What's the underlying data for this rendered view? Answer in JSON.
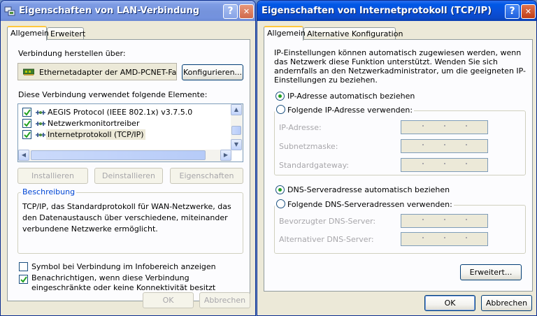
{
  "lan": {
    "title": "Eigenschaften von LAN-Verbindung",
    "tabs": [
      "Allgemein",
      "Erweitert"
    ],
    "connect_label": "Verbindung herstellen über:",
    "adapter": "Ethernetadapter der AMD-PCNET-Fa",
    "configure_button": "Konfigurieren...",
    "elements_label": "Diese Verbindung verwendet folgende Elemente:",
    "items": [
      {
        "label": "AEGIS Protocol (IEEE 802.1x) v3.7.5.0",
        "checked": true,
        "selected": false
      },
      {
        "label": "Netzwerkmonitortreiber",
        "checked": true,
        "selected": false
      },
      {
        "label": "Internetprotokoll (TCP/IP)",
        "checked": true,
        "selected": true
      }
    ],
    "install_button": "Installieren",
    "uninstall_button": "Deinstallieren",
    "properties_button": "Eigenschaften",
    "description_title": "Beschreibung",
    "description_text": "TCP/IP, das Standardprotokoll für WAN-Netzwerke, das den Datenaustausch über verschiedene, miteinander verbundene Netzwerke ermöglicht.",
    "show_icon_label": "Symbol bei Verbindung im Infobereich anzeigen",
    "show_icon_checked": false,
    "notify_label": "Benachrichtigen, wenn diese Verbindung eingeschränkte oder keine Konnektivität besitzt",
    "notify_checked": true,
    "ok_button": "OK",
    "cancel_button": "Abbrechen"
  },
  "tcp": {
    "title": "Eigenschaften von Internetprotokoll (TCP/IP)",
    "tabs": [
      "Allgemein",
      "Alternative Konfiguration"
    ],
    "intro": "IP-Einstellungen können automatisch zugewiesen werden, wenn das Netzwerk diese Funktion unterstützt. Wenden Sie sich andernfalls an den Netzwerkadministrator, um die geeigneten IP-Einstellungen zu beziehen.",
    "ip_auto_label": "IP-Adresse automatisch beziehen",
    "ip_auto_selected": true,
    "ip_manual_label": "Folgende IP-Adresse verwenden:",
    "ip_address_label": "IP-Adresse:",
    "subnet_label": "Subnetzmaske:",
    "gateway_label": "Standardgateway:",
    "dns_auto_label": "DNS-Serveradresse automatisch beziehen",
    "dns_auto_selected": true,
    "dns_manual_label": "Folgende DNS-Serveradressen verwenden:",
    "dns_pref_label": "Bevorzugter DNS-Server:",
    "dns_alt_label": "Alternativer DNS-Server:",
    "advanced_button": "Erweitert...",
    "ok_button": "OK",
    "cancel_button": "Abbrechen"
  },
  "titlebar_buttons": {
    "help": "?",
    "close": "✕"
  },
  "colors": {
    "active_title": "#0a4fd8",
    "inactive_title": "#7593dc",
    "face": "#ece9d8",
    "panel": "#fcfcfe",
    "tab_highlight": "#ffc83c",
    "selection": "#ece9d8"
  }
}
